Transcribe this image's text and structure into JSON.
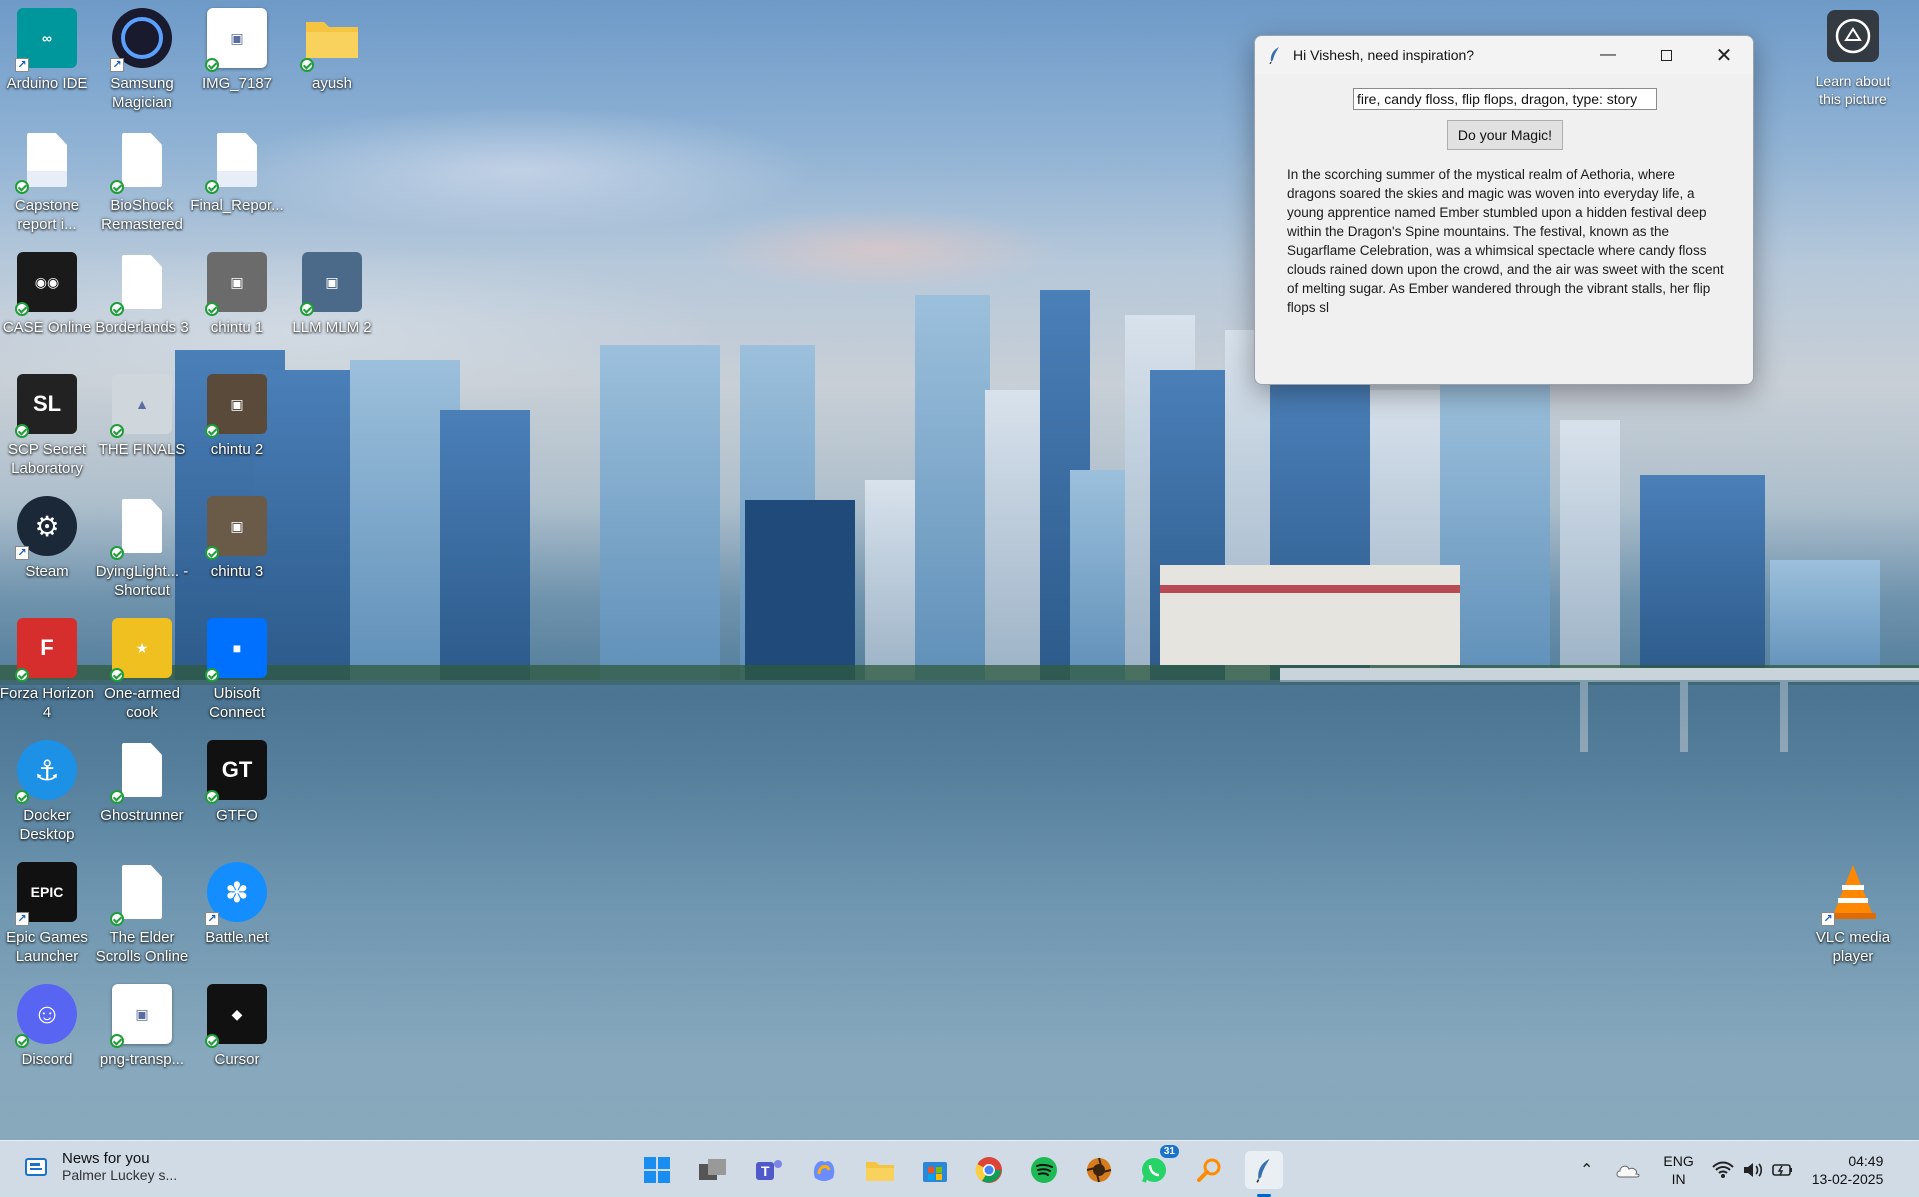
{
  "window": {
    "title": "Hi Vishesh, need inspiration?",
    "prompt_value": "fire, candy floss, flip flops, dragon, type: story",
    "button_label": "Do your Magic!",
    "story_text": "In the scorching summer of the mystical realm of Aethoria, where dragons soared the skies and magic was woven into everyday life, a young apprentice named Ember stumbled upon a hidden festival deep within the Dragon's Spine mountains. The festival, known as the Sugarflame Celebration, was a whimsical spectacle where candy floss clouds rained down upon the crowd, and the air was sweet with the scent of melting sugar. As Ember wandered through the vibrant stalls, her flip flops sl"
  },
  "desktop": {
    "icons": [
      {
        "label": "Arduino IDE",
        "icon": "arduino-icon",
        "color": "#00979c"
      },
      {
        "label": "Samsung Magician",
        "icon": "samsung-magician-icon",
        "color": "#1a1a2e"
      },
      {
        "label": "IMG_7187",
        "icon": "image-thumbnail-icon",
        "color": "#ffffff"
      },
      {
        "label": "ayush",
        "icon": "folder-icon",
        "color": "#f5c542"
      },
      {
        "label": "Capstone report i...",
        "icon": "word-doc-icon",
        "color": "#ffffff"
      },
      {
        "label": "BioShock Remastered",
        "icon": "blank-doc-icon",
        "color": "#ffffff"
      },
      {
        "label": "Final_Repor...",
        "icon": "word-doc-icon",
        "color": "#ffffff"
      },
      {
        "label": "CASE Online",
        "icon": "case-online-icon",
        "color": "#1a1a1a"
      },
      {
        "label": "Borderlands 3",
        "icon": "blank-doc-icon",
        "color": "#ffffff"
      },
      {
        "label": "chintu 1",
        "icon": "photo-icon",
        "color": "#6b6b6b"
      },
      {
        "label": "LLM MLM 2",
        "icon": "photo-icon",
        "color": "#4b6a8a"
      },
      {
        "label": "SCP Secret Laboratory",
        "icon": "scp-icon",
        "color": "#222222"
      },
      {
        "label": "THE FINALS",
        "icon": "the-finals-icon",
        "color": "#cfd6dc"
      },
      {
        "label": "chintu 2",
        "icon": "photo-icon",
        "color": "#5a4a3a"
      },
      {
        "label": "Steam",
        "icon": "steam-icon",
        "color": "#1b2838"
      },
      {
        "label": "DyingLight... - Shortcut",
        "icon": "blank-doc-icon",
        "color": "#ffffff"
      },
      {
        "label": "chintu 3",
        "icon": "photo-icon",
        "color": "#6a5a48"
      },
      {
        "label": "Forza Horizon 4",
        "icon": "forza-icon",
        "color": "#d62d2d"
      },
      {
        "label": "One-armed cook",
        "icon": "one-armed-cook-icon",
        "color": "#f0c020"
      },
      {
        "label": "Ubisoft Connect",
        "icon": "ubisoft-connect-icon",
        "color": "#0070ff"
      },
      {
        "label": "Docker Desktop",
        "icon": "docker-icon",
        "color": "#1d91e6"
      },
      {
        "label": "Ghostrunner",
        "icon": "blank-doc-icon",
        "color": "#ffffff"
      },
      {
        "label": "GTFO",
        "icon": "gtfo-icon",
        "color": "#111111"
      },
      {
        "label": "Epic Games Launcher",
        "icon": "epic-games-icon",
        "color": "#111111"
      },
      {
        "label": "The Elder Scrolls Online",
        "icon": "blank-doc-icon",
        "color": "#ffffff"
      },
      {
        "label": "Battle.net",
        "icon": "battlenet-icon",
        "color": "#148eff"
      },
      {
        "label": "Discord",
        "icon": "discord-icon",
        "color": "#5865f2"
      },
      {
        "label": "png-transp...",
        "icon": "image-thumbnail-icon",
        "color": "#ffffff"
      },
      {
        "label": "Cursor",
        "icon": "cursor-app-icon",
        "color": "#111111"
      },
      {
        "label": "VLC media player",
        "icon": "vlc-icon",
        "color": "#ff8800"
      }
    ],
    "learn_label": "Learn about this picture"
  },
  "taskbar": {
    "news_title": "News for you",
    "news_sub": "Palmer Luckey s...",
    "whatsapp_badge": "31",
    "lang_1": "ENG",
    "lang_2": "IN",
    "time": "04:49",
    "date": "13-02-2025"
  }
}
